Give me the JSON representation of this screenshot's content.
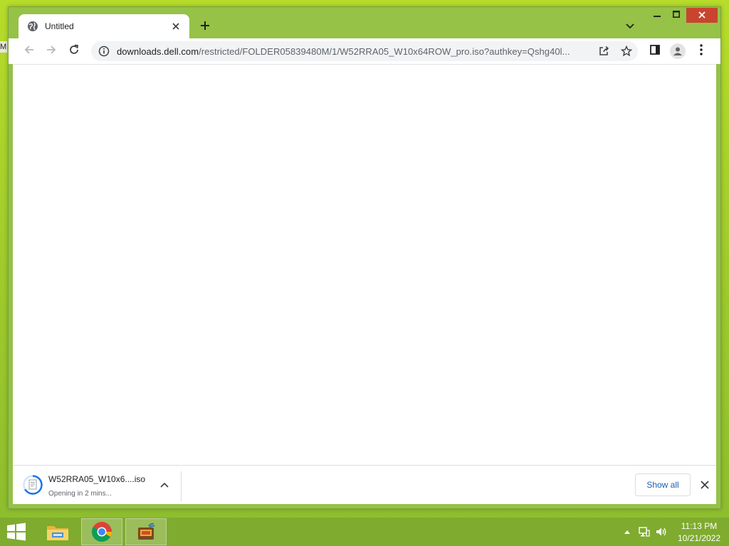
{
  "desktop": {
    "edge_text": "M"
  },
  "browser": {
    "tab": {
      "title": "Untitled",
      "favicon": "globe-icon"
    },
    "window_controls": [
      "minimize-icon",
      "maximize-icon",
      "close-icon"
    ],
    "toolbar": {
      "url_host": "downloads.dell.com",
      "url_path": "/restricted/FOLDER05839480M/1/W52RRA05_W10x64ROW_pro.iso?authkey=Qshg40l...",
      "icons": [
        "back-arrow-icon",
        "forward-arrow-icon",
        "reload-icon",
        "info-icon",
        "share-icon",
        "bookmark-star-icon",
        "side-panel-icon",
        "profile-avatar-icon",
        "kebab-menu-icon"
      ]
    },
    "downloads": {
      "item": {
        "name": "W52RRA05_W10x6....iso",
        "status": "Opening in 2 mins..."
      },
      "show_all_label": "Show all"
    }
  },
  "taskbar": {
    "apps": [
      "file-explorer-icon",
      "chrome-icon",
      "media-app-icon"
    ],
    "clock": {
      "time": "11:13 PM",
      "date": "10/21/2022"
    }
  },
  "colors": {
    "window_frame": "#95c247",
    "desktop": "#a9d22c",
    "taskbar": "#7fab2f",
    "close_red": "#c9442f",
    "link_blue": "#1a5fb4"
  }
}
